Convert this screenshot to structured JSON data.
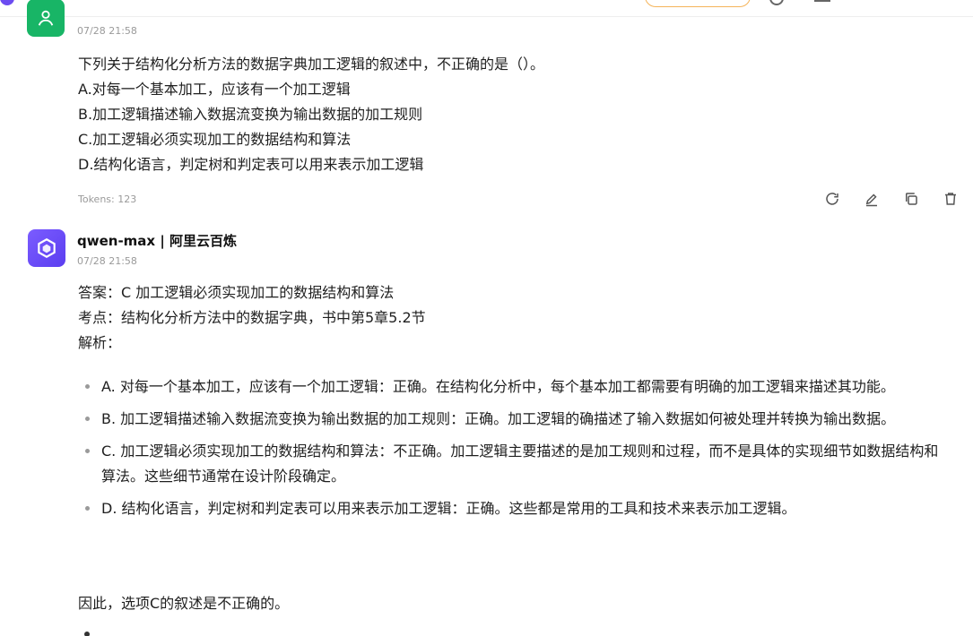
{
  "user_message": {
    "timestamp": "07/28 21:58",
    "lines": [
      "下列关于结构化分析方法的数据字典加工逻辑的叙述中，不正确的是（）。",
      "A.对每一个基本加工，应该有一个加工逻辑",
      "B.加工逻辑描述输入数据流变换为输出数据的加工规则",
      "C.加工逻辑必须实现加工的数据结构和算法",
      "D.结构化语言，判定树和判定表可以用来表示加工逻辑"
    ],
    "tokens": "Tokens: 123"
  },
  "actions": {
    "icons": [
      "refresh-icon",
      "edit-icon",
      "copy-icon",
      "delete-icon"
    ]
  },
  "assistant_message": {
    "model": "qwen-max | 阿里云百炼",
    "timestamp": "07/28 21:58",
    "lines": [
      "答案：C 加工逻辑必须实现加工的数据结构和算法",
      "考点：结构化分析方法中的数据字典，书中第5章5.2节",
      "解析："
    ],
    "bullets": [
      "A. 对每一个基本加工，应该有一个加工逻辑：正确。在结构化分析中，每个基本加工都需要有明确的加工逻辑来描述其功能。",
      "B. 加工逻辑描述输入数据流变换为输出数据的加工规则：正确。加工逻辑的确描述了输入数据如何被处理并转换为输出数据。",
      "C. 加工逻辑必须实现加工的数据结构和算法：不正确。加工逻辑主要描述的是加工规则和过程，而不是具体的实现细节如数据结构和算法。这些细节通常在设计阶段确定。",
      "D. 结构化语言，判定树和判定表可以用来表示加工逻辑：正确。这些都是常用的工具和技术来表示加工逻辑。"
    ],
    "conclusion": "因此，选项C的叙述是不正确的。"
  },
  "colors": {
    "user_avatar": "#18b566",
    "bot_avatar": "#6c4cf1",
    "muted_text": "#9a9a9a"
  }
}
